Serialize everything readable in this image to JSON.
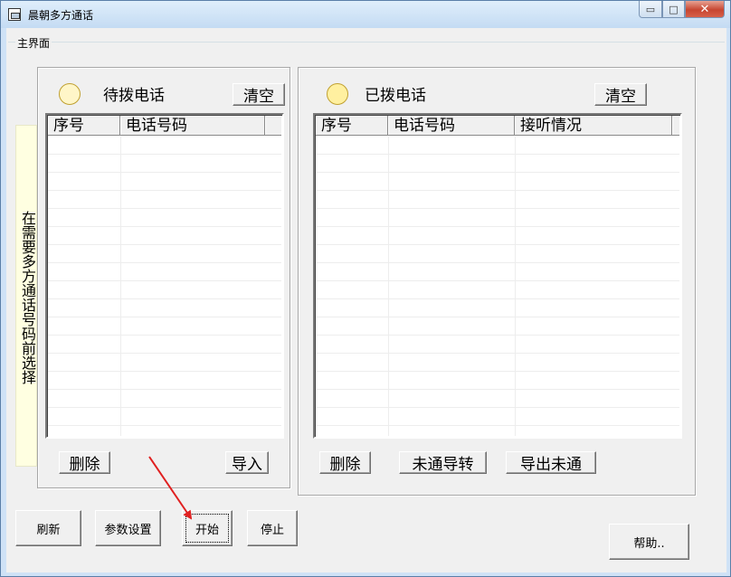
{
  "window": {
    "title": "晨朝多方通话",
    "controls": {
      "minimize": "▭",
      "maximize": "□",
      "close": "✕"
    }
  },
  "main": {
    "group_label": "主界面",
    "side_note": "在需要多方通话号码前选择"
  },
  "pending": {
    "title": "待拨电话",
    "clear_label": "清空",
    "columns": [
      "序号",
      "电话号码"
    ],
    "rows": [],
    "delete_label": "删除",
    "import_label": "导入",
    "lamp_color": "#fff6c8"
  },
  "dialed": {
    "title": "已拨电话",
    "clear_label": "清空",
    "columns": [
      "序号",
      "电话号码",
      "接听情况"
    ],
    "rows": [],
    "delete_label": "删除",
    "transfer_label": "未通导转",
    "export_label": "导出未通",
    "lamp_color": "#fff0a0"
  },
  "footer": {
    "refresh_label": "刷新",
    "settings_label": "参数设置",
    "start_label": "开始",
    "stop_label": "停止",
    "help_label": "帮助.."
  },
  "annotation": {
    "arrow_color": "#e02020"
  }
}
